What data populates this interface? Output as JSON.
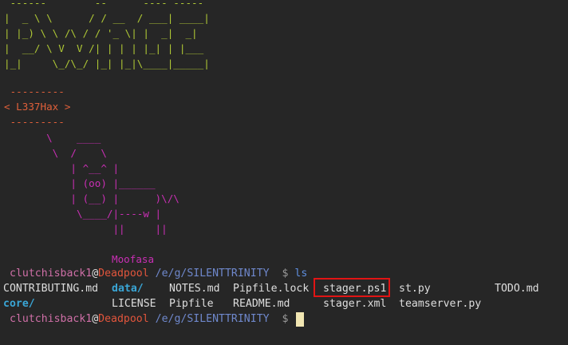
{
  "banner": {
    "art": " ------        --      ---- -----\n|  _ \\ \\      / / __  / ___| ____|\n| |_) \\ \\ /\\ / / '_ \\| |  _|  _|\n|  __/ \\ V  V /| | | | |_| | |___\n|_|     \\_/\\_/ |_| |_|\\____|_____|"
  },
  "cowsay": {
    "art": " ---------\n< L337Hax >\n ---------"
  },
  "cow": {
    "art": "       \\    ____\n        \\  /    \\\n           | ^__^ |\n           | (oo) |______\n           | (__) |      )\\/\\\n            \\____/|----w |\n                  ||     ||",
    "name": "Moofasa"
  },
  "prompt1": {
    "user": "clutchisback1",
    "at": "@",
    "host": "Deadpool",
    "path": "/e/g/SILENTTRINITY",
    "symbol": "$",
    "command": "ls"
  },
  "ls_output": {
    "row1": [
      "CONTRIBUTING.md",
      "data/",
      "NOTES.md",
      "Pipfile.lock",
      "stager.ps1",
      "st.py",
      "TODO.md"
    ],
    "row2": [
      "core/",
      "LICENSE",
      "Pipfile",
      "README.md",
      "stager.xml",
      "teamserver.py"
    ]
  },
  "prompt2": {
    "user": "clutchisback1",
    "at": "@",
    "host": "Deadpool",
    "path": "/e/g/SILENTTRINITY",
    "symbol": "$"
  },
  "colors": {
    "background": "#262626",
    "banner": "#aec735",
    "cowsay": "#e0603a",
    "cow": "#c92fb4",
    "highlight": "#e11414",
    "directory": "#3aa6d6",
    "cursor": "#f1e6b2"
  }
}
